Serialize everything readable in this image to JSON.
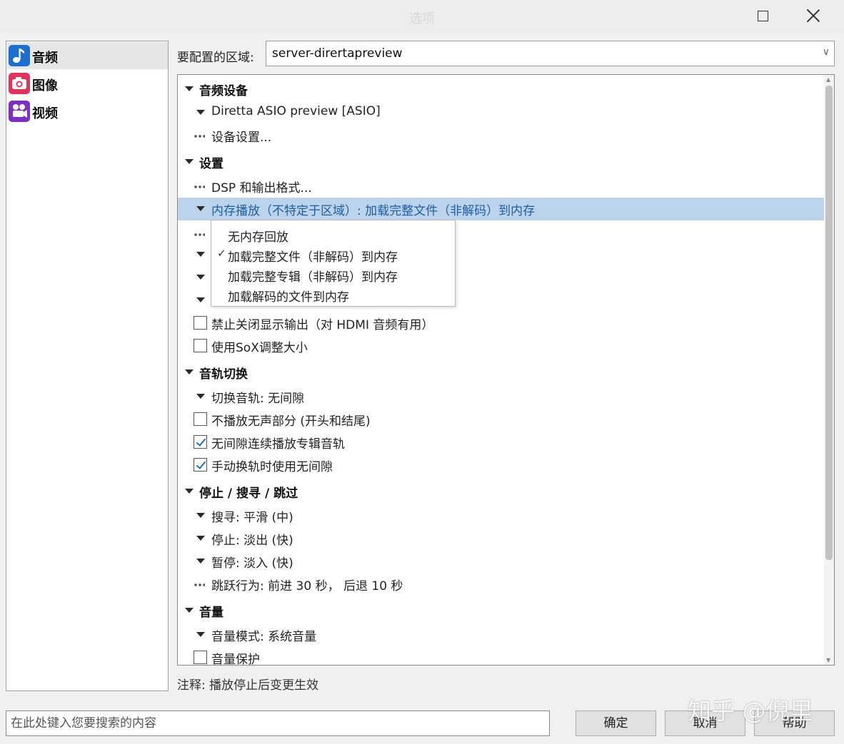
{
  "window": {
    "title": "选项"
  },
  "sidebar": {
    "items": [
      {
        "label": "音频",
        "icon": "music-note-icon",
        "color": "#1c6fd0",
        "selected": true
      },
      {
        "label": "图像",
        "icon": "camera-icon",
        "color": "#e0345c",
        "selected": false
      },
      {
        "label": "视频",
        "icon": "film-camera-icon",
        "color": "#7b2fc4",
        "selected": false
      }
    ]
  },
  "region": {
    "label": "要配置的区域:",
    "value": "server-dirertapreview"
  },
  "tree": [
    {
      "kind": "group",
      "text": "音频设备"
    },
    {
      "kind": "expand",
      "text": "Diretta ASIO preview [ASIO]"
    },
    {
      "kind": "leaf",
      "text": "设备设置..."
    },
    {
      "kind": "group",
      "text": "设置"
    },
    {
      "kind": "leaf",
      "text": "DSP 和输出格式..."
    },
    {
      "kind": "expand",
      "text": "内存播放（不特定于区域）: 加载完整文件（非解码）到内存",
      "selected": true
    },
    {
      "kind": "leaf",
      "text": ""
    },
    {
      "kind": "expand",
      "text": ""
    },
    {
      "kind": "expand",
      "text": ""
    },
    {
      "kind": "expand",
      "text": ""
    },
    {
      "kind": "checkbox",
      "checked": false,
      "text": "禁止关闭显示输出（对 HDMI 音频有用）"
    },
    {
      "kind": "checkbox",
      "checked": false,
      "text": "使用SoX调整大小"
    },
    {
      "kind": "group",
      "text": "音轨切换"
    },
    {
      "kind": "expand",
      "text": "切换音轨: 无间隙"
    },
    {
      "kind": "checkbox",
      "checked": false,
      "text": "不播放无声部分 (开头和结尾)"
    },
    {
      "kind": "checkbox",
      "checked": true,
      "text": "无间隙连续播放专辑音轨"
    },
    {
      "kind": "checkbox",
      "checked": true,
      "text": "手动换轨时使用无间隙"
    },
    {
      "kind": "group",
      "text": "停止 / 搜寻 / 跳过"
    },
    {
      "kind": "expand",
      "text": "搜寻: 平滑 (中)"
    },
    {
      "kind": "expand",
      "text": "停止: 淡出 (快)"
    },
    {
      "kind": "expand",
      "text": "暂停: 淡入 (快)"
    },
    {
      "kind": "leaf",
      "text": "跳跃行为: 前进 30 秒， 后退 10 秒"
    },
    {
      "kind": "group",
      "text": "音量"
    },
    {
      "kind": "expand",
      "text": "音量模式: 系统音量"
    },
    {
      "kind": "checkbox",
      "checked": false,
      "text": "音量保护"
    }
  ],
  "popup": {
    "options": [
      {
        "text": "无内存回放",
        "checked": false
      },
      {
        "text": "加载完整文件（非解码）到内存",
        "checked": true
      },
      {
        "text": "加载完整专辑（非解码）到内存",
        "checked": false
      },
      {
        "text": "加载解码的文件到内存",
        "checked": false
      }
    ],
    "check_mark": "✓"
  },
  "note": "注释: 播放停止后变更生效",
  "search": {
    "placeholder": "在此处键入您要搜索的内容"
  },
  "buttons": {
    "ok": "确定",
    "cancel": "取消",
    "help": "帮助"
  },
  "watermark": "知乎 @倪里"
}
